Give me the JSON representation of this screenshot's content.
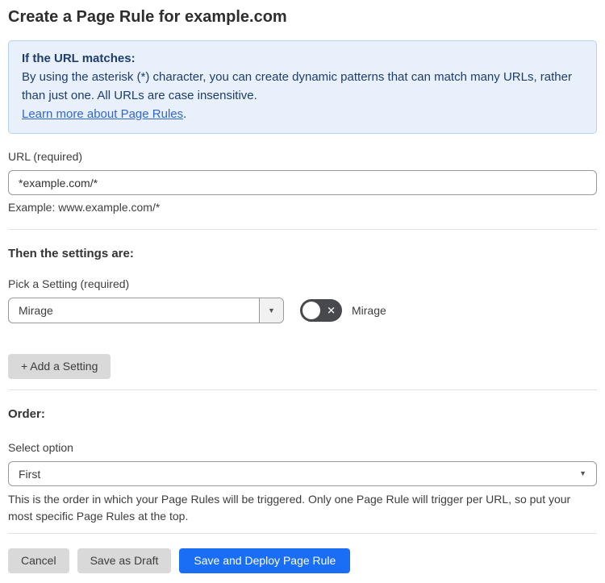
{
  "page": {
    "title": "Create a Page Rule for example.com"
  },
  "info_box": {
    "heading": "If the URL matches:",
    "body": "By using the asterisk (*) character, you can create dynamic patterns that can match many URLs, rather than just one. All URLs are case insensitive.",
    "link_label": "Learn more about Page Rules",
    "link_suffix": "."
  },
  "url_field": {
    "label": "URL (required)",
    "value": "*example.com/*",
    "example": "Example: www.example.com/*"
  },
  "settings_section": {
    "heading": "Then the settings are:",
    "picker_label": "Pick a Setting (required)",
    "picker_value": "Mirage",
    "toggle_label": "Mirage",
    "toggle_state": "off",
    "add_setting_label": "+ Add a Setting"
  },
  "order_section": {
    "heading": "Order:",
    "select_label": "Select option",
    "select_value": "First",
    "help_text": "This is the order in which your Page Rules will be triggered. Only one Page Rule will trigger per URL, so put your most specific Page Rules at the top."
  },
  "footer": {
    "cancel_label": "Cancel",
    "save_draft_label": "Save as Draft",
    "save_deploy_label": "Save and Deploy Page Rule"
  },
  "glyphs": {
    "caret_down": "▼",
    "close_x": "✕"
  },
  "colors": {
    "accent_blue": "#1a6ef5",
    "info_background": "#e8f1fb",
    "info_border": "#b5d2f0",
    "info_text": "#1e3c6d",
    "link_blue": "#3366cc",
    "toggle_off_background": "#47494d",
    "button_gray": "#d9d9d9"
  }
}
